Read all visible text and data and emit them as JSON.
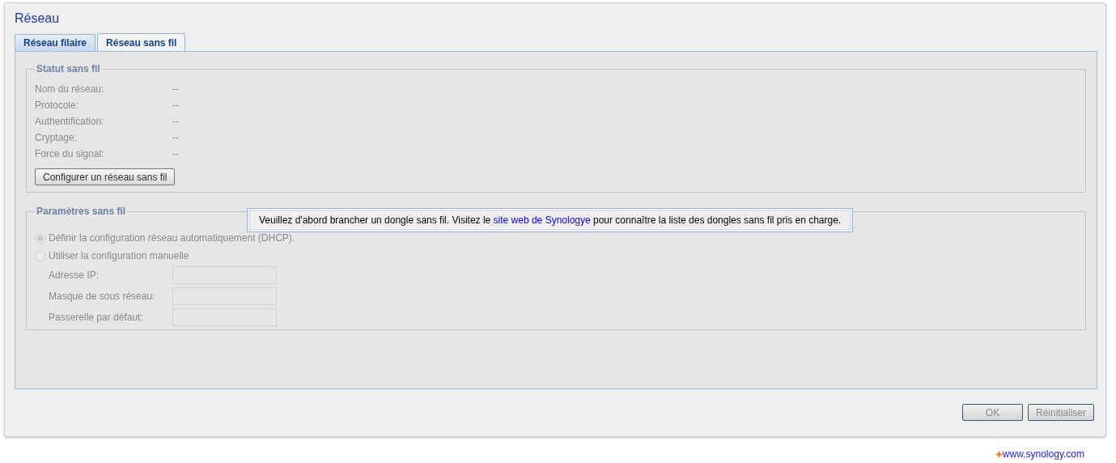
{
  "window": {
    "title": "Réseau"
  },
  "tabs": [
    {
      "label": "Réseau filaire",
      "selected": false
    },
    {
      "label": "Réseau sans fil",
      "selected": true
    }
  ],
  "status": {
    "legend": "Statut sans fil",
    "rows": [
      {
        "label": "Nom du réseau:",
        "value": "--"
      },
      {
        "label": "Protocole:",
        "value": "--"
      },
      {
        "label": "Authentification:",
        "value": "--"
      },
      {
        "label": "Cryptage:",
        "value": "--"
      },
      {
        "label": "Force du signal:",
        "value": "--"
      }
    ],
    "button": "Configurer un réseau sans fil"
  },
  "settings": {
    "legend": "Paramètres sans fil",
    "options": [
      {
        "label": "Définir la configuration réseau automatiquement (DHCP).",
        "selected": true
      },
      {
        "label": "Utiliser la configuration manuelle",
        "selected": false
      }
    ],
    "fields": [
      {
        "label": "Adresse IP:"
      },
      {
        "label": "Masque de sous réseau:"
      },
      {
        "label": "Passerelle par défaut:"
      }
    ],
    "disabled": true
  },
  "tooltip": {
    "before": "Veuillez d'abord brancher un dongle sans fil. Visitez le ",
    "link": "site web de Synologye",
    "after": " pour connaître la liste des dongles sans fil pris en charge."
  },
  "buttons": [
    {
      "label": "OK",
      "disabled": true
    },
    {
      "label": "Réinitialiser",
      "disabled": true
    }
  ],
  "footer": {
    "link": "www.synology.com"
  }
}
